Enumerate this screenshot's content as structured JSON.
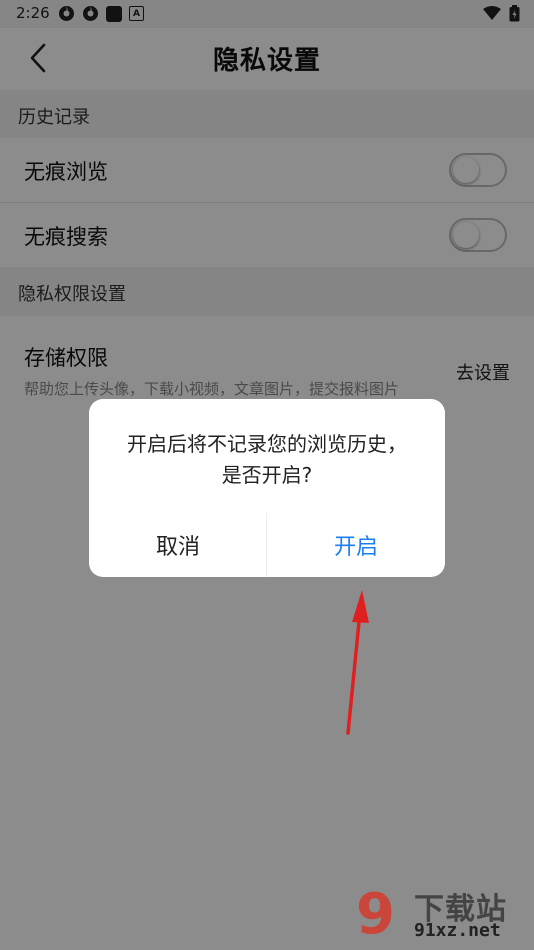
{
  "status_bar": {
    "time": "2:26",
    "notification_icons": [
      "app-icon",
      "app-icon",
      "square-icon",
      "a-icon"
    ],
    "right_icons": [
      "wifi-icon",
      "battery-icon"
    ]
  },
  "header": {
    "title": "隐私设置"
  },
  "sections": [
    {
      "title": "历史记录",
      "rows": [
        {
          "label": "无痕浏览",
          "toggle_on": false
        },
        {
          "label": "无痕搜索",
          "toggle_on": false
        }
      ]
    },
    {
      "title": "隐私权限设置",
      "rows": [
        {
          "label": "存储权限",
          "description": "帮助您上传头像，下载小视频，文章图片，提交报料图片",
          "action": "去设置"
        }
      ]
    }
  ],
  "dialog": {
    "message_line1": "开启后将不记录您的浏览历史，",
    "message_line2": "是否开启?",
    "cancel_label": "取消",
    "confirm_label": "开启",
    "confirm_color": "#1a7ef0"
  },
  "annotation": {
    "color": "#e02020"
  },
  "watermark": {
    "logo_mark": "9",
    "brand_text": "下载站",
    "site": "91xz.net",
    "color": "#d73a2c"
  }
}
